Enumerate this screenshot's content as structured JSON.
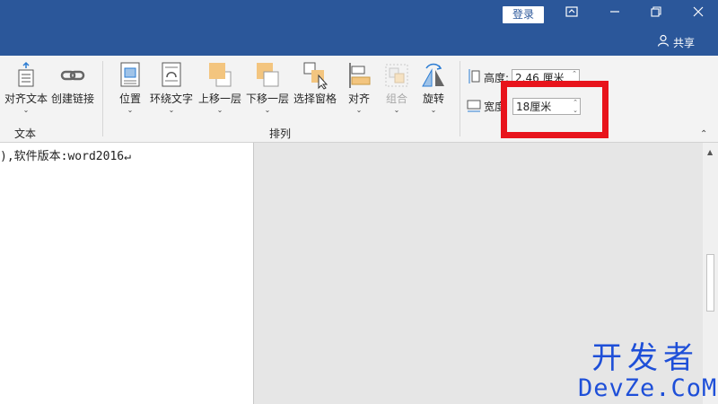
{
  "titlebar": {
    "login_label": "登录",
    "share_label": "共享"
  },
  "ribbon": {
    "buttons_text_group": [
      {
        "label": "对齐文本",
        "icon": "align-text-icon"
      },
      {
        "label": "创建链接",
        "icon": "link-icon"
      }
    ],
    "text_group_label": "文本",
    "buttons_arrange": [
      {
        "label": "位置",
        "icon": "position-icon"
      },
      {
        "label": "环绕文字",
        "icon": "wrap-text-icon"
      },
      {
        "label": "上移一层",
        "icon": "bring-forward-icon"
      },
      {
        "label": "下移一层",
        "icon": "send-backward-icon"
      },
      {
        "label": "选择窗格",
        "icon": "selection-pane-icon"
      },
      {
        "label": "对齐",
        "icon": "align-icon"
      },
      {
        "label": "组合",
        "icon": "group-icon",
        "disabled": true
      },
      {
        "label": "旋转",
        "icon": "rotate-icon"
      }
    ],
    "arrange_group_label": "排列",
    "size": {
      "height_label": "高度:",
      "height_value": "2.46 厘米",
      "width_label": "宽度",
      "width_value": "18厘米"
    }
  },
  "document": {
    "text": "),软件版本:word2016↵"
  },
  "watermark": {
    "line1": "开发者",
    "line2": "DevZe.CoM"
  },
  "colors": {
    "titlebar": "#2b579a",
    "highlight": "#e8141c",
    "watermark": "#1e4fd8"
  }
}
